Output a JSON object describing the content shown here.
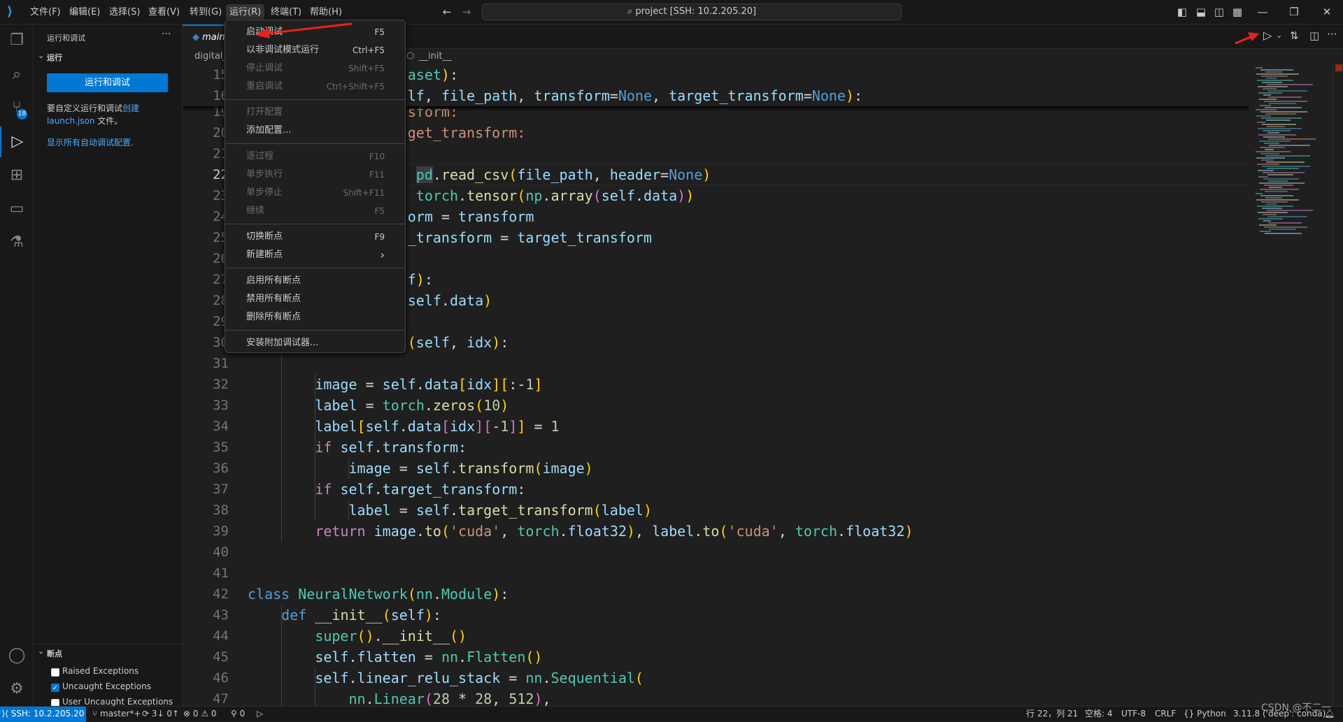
{
  "titlebar": {
    "menus": [
      "文件(F)",
      "编辑(E)",
      "选择(S)",
      "查看(V)",
      "转到(G)",
      "运行(R)",
      "终端(T)",
      "帮助(H)"
    ],
    "active_menu": "运行(R)",
    "search_text": "project [SSH: 10.2.205.20]"
  },
  "activity_bar": {
    "source_control_badge": "18"
  },
  "sidebar": {
    "title": "运行和调试",
    "section": "运行",
    "run_button": "运行和调试",
    "hint_prefix": "要自定义运行和调试",
    "hint_link": "创建",
    "hint_link2": "launch.json",
    "hint_suffix": " 文件。",
    "show_all": "显示所有自动调试配置.",
    "breakpoints_title": "断点",
    "breakpoints": [
      {
        "label": "Raised Exceptions",
        "checked": false
      },
      {
        "label": "Uncaught Exceptions",
        "checked": true
      },
      {
        "label": "User Uncaught Exceptions",
        "checked": false
      }
    ]
  },
  "tabs": [
    {
      "label": "main",
      "preview": true
    }
  ],
  "breadcrumb": {
    "file": "digital_",
    "symbol": "__init__"
  },
  "run_menu": [
    [
      {
        "label": "启动调试",
        "shortcut": "F5",
        "disabled": false
      },
      {
        "label": "以非调试模式运行",
        "shortcut": "Ctrl+F5",
        "disabled": false
      },
      {
        "label": "停止调试",
        "shortcut": "Shift+F5",
        "disabled": true
      },
      {
        "label": "重启调试",
        "shortcut": "Ctrl+Shift+F5",
        "disabled": true
      }
    ],
    [
      {
        "label": "打开配置",
        "shortcut": "",
        "disabled": true
      },
      {
        "label": "添加配置...",
        "shortcut": "",
        "disabled": false
      }
    ],
    [
      {
        "label": "逐过程",
        "shortcut": "F10",
        "disabled": true
      },
      {
        "label": "单步执行",
        "shortcut": "F11",
        "disabled": true
      },
      {
        "label": "单步停止",
        "shortcut": "Shift+F11",
        "disabled": true
      },
      {
        "label": "继续",
        "shortcut": "F5",
        "disabled": true
      }
    ],
    [
      {
        "label": "切换断点",
        "shortcut": "F9",
        "disabled": false
      },
      {
        "label": "新建断点",
        "shortcut": "",
        "submenu": true,
        "disabled": false
      }
    ],
    [
      {
        "label": "启用所有断点",
        "shortcut": "",
        "disabled": false
      },
      {
        "label": "禁用所有断点",
        "shortcut": "",
        "disabled": false
      },
      {
        "label": "删除所有断点",
        "shortcut": "",
        "disabled": false
      }
    ],
    [
      {
        "label": "安装附加调试器...",
        "shortcut": "",
        "disabled": false
      }
    ]
  ],
  "editor": {
    "current_line": 22,
    "sticky": [
      {
        "n": 15,
        "col": 19,
        "tokens": [
          [
            "aset",
            "t"
          ],
          [
            ")",
            "b1"
          ],
          [
            ":",
            "p"
          ]
        ]
      },
      {
        "n": 16,
        "col": 19,
        "tokens": [
          [
            "lf",
            "v"
          ],
          [
            ", ",
            "p"
          ],
          [
            "file_path",
            "v"
          ],
          [
            ", ",
            "p"
          ],
          [
            "transform",
            "v"
          ],
          [
            "=",
            "p"
          ],
          [
            "None",
            "d"
          ],
          [
            ", ",
            "p"
          ],
          [
            "target_transform",
            "v"
          ],
          [
            "=",
            "p"
          ],
          [
            "None",
            "d"
          ],
          [
            ")",
            "b1"
          ],
          [
            ":",
            "p"
          ]
        ]
      }
    ],
    "lines": [
      {
        "n": 19,
        "col": 19,
        "tokens": [
          [
            "sform:",
            "o"
          ]
        ]
      },
      {
        "n": 20,
        "col": 19,
        "tokens": [
          [
            "get_transform:",
            "o"
          ]
        ]
      },
      {
        "n": 21,
        "col": 0,
        "tokens": []
      },
      {
        "n": 22,
        "col": 20,
        "tokens": [
          [
            "pd",
            "t hl"
          ],
          [
            ".",
            "p"
          ],
          [
            "read_csv",
            "f"
          ],
          [
            "(",
            "b1"
          ],
          [
            "file_path",
            "v"
          ],
          [
            ", ",
            "p"
          ],
          [
            "header",
            "v"
          ],
          [
            "=",
            "p"
          ],
          [
            "None",
            "d"
          ],
          [
            ")",
            "b1"
          ]
        ]
      },
      {
        "n": 23,
        "col": 20,
        "tokens": [
          [
            "torch",
            "t"
          ],
          [
            ".",
            "p"
          ],
          [
            "tensor",
            "f"
          ],
          [
            "(",
            "b1"
          ],
          [
            "np",
            "t"
          ],
          [
            ".",
            "p"
          ],
          [
            "array",
            "f"
          ],
          [
            "(",
            "b2"
          ],
          [
            "self",
            "v"
          ],
          [
            ".",
            "p"
          ],
          [
            "data",
            "v"
          ],
          [
            ")",
            "b2"
          ],
          [
            ")",
            "b1"
          ]
        ]
      },
      {
        "n": 24,
        "col": 19,
        "tokens": [
          [
            "orm",
            "v"
          ],
          [
            " = ",
            "p"
          ],
          [
            "transform",
            "v"
          ]
        ]
      },
      {
        "n": 25,
        "col": 19,
        "tokens": [
          [
            "_transform",
            "v"
          ],
          [
            " = ",
            "p"
          ],
          [
            "target_transform",
            "v"
          ]
        ]
      },
      {
        "n": 26,
        "col": 0,
        "tokens": []
      },
      {
        "n": 27,
        "col": 19,
        "tokens": [
          [
            "f",
            "v"
          ],
          [
            ")",
            "b1"
          ],
          [
            ":",
            "p"
          ]
        ]
      },
      {
        "n": 28,
        "col": 19,
        "tokens": [
          [
            "self",
            "v"
          ],
          [
            ".",
            "p"
          ],
          [
            "data",
            "v"
          ],
          [
            ")",
            "b1"
          ]
        ]
      },
      {
        "n": 29,
        "col": 0,
        "tokens": []
      },
      {
        "n": 30,
        "col": 19,
        "tokens": [
          [
            "(",
            "b1"
          ],
          [
            "self",
            "v"
          ],
          [
            ", ",
            "p"
          ],
          [
            "idx",
            "v"
          ],
          [
            ")",
            "b1"
          ],
          [
            ":",
            "p"
          ]
        ]
      },
      {
        "n": 31,
        "col": 0,
        "tokens": []
      },
      {
        "n": 32,
        "col": 8,
        "tokens": [
          [
            "image",
            "v"
          ],
          [
            " = ",
            "p"
          ],
          [
            "self",
            "v"
          ],
          [
            ".",
            "p"
          ],
          [
            "data",
            "v"
          ],
          [
            "[",
            "b1"
          ],
          [
            "idx",
            "v"
          ],
          [
            "]",
            "b1"
          ],
          [
            "[",
            "b1"
          ],
          [
            ":-",
            "p"
          ],
          [
            "1",
            "n"
          ],
          [
            "]",
            "b1"
          ]
        ]
      },
      {
        "n": 33,
        "col": 8,
        "tokens": [
          [
            "label",
            "v"
          ],
          [
            " = ",
            "p"
          ],
          [
            "torch",
            "t"
          ],
          [
            ".",
            "p"
          ],
          [
            "zeros",
            "f"
          ],
          [
            "(",
            "b1"
          ],
          [
            "10",
            "n"
          ],
          [
            ")",
            "b1"
          ]
        ]
      },
      {
        "n": 34,
        "col": 8,
        "tokens": [
          [
            "label",
            "v"
          ],
          [
            "[",
            "b1"
          ],
          [
            "self",
            "v"
          ],
          [
            ".",
            "p"
          ],
          [
            "data",
            "v"
          ],
          [
            "[",
            "b2"
          ],
          [
            "idx",
            "v"
          ],
          [
            "]",
            "b2"
          ],
          [
            "[",
            "b2"
          ],
          [
            "-",
            "p"
          ],
          [
            "1",
            "n"
          ],
          [
            "]",
            "b2"
          ],
          [
            "]",
            "b1"
          ],
          [
            " = ",
            "p"
          ],
          [
            "1",
            "n"
          ]
        ]
      },
      {
        "n": 35,
        "col": 8,
        "tokens": [
          [
            "if",
            "k"
          ],
          [
            " ",
            "p"
          ],
          [
            "self",
            "v"
          ],
          [
            ".",
            "p"
          ],
          [
            "transform",
            "v"
          ],
          [
            ":",
            "p"
          ]
        ]
      },
      {
        "n": 36,
        "col": 12,
        "tokens": [
          [
            "image",
            "v"
          ],
          [
            " = ",
            "p"
          ],
          [
            "self",
            "v"
          ],
          [
            ".",
            "p"
          ],
          [
            "transform",
            "f"
          ],
          [
            "(",
            "b1"
          ],
          [
            "image",
            "v"
          ],
          [
            ")",
            "b1"
          ]
        ]
      },
      {
        "n": 37,
        "col": 8,
        "tokens": [
          [
            "if",
            "k"
          ],
          [
            " ",
            "p"
          ],
          [
            "self",
            "v"
          ],
          [
            ".",
            "p"
          ],
          [
            "target_transform",
            "v"
          ],
          [
            ":",
            "p"
          ]
        ]
      },
      {
        "n": 38,
        "col": 12,
        "tokens": [
          [
            "label",
            "v"
          ],
          [
            " = ",
            "p"
          ],
          [
            "self",
            "v"
          ],
          [
            ".",
            "p"
          ],
          [
            "target_transform",
            "f"
          ],
          [
            "(",
            "b1"
          ],
          [
            "label",
            "v"
          ],
          [
            ")",
            "b1"
          ]
        ]
      },
      {
        "n": 39,
        "col": 8,
        "tokens": [
          [
            "return",
            "k"
          ],
          [
            " ",
            "p"
          ],
          [
            "image",
            "v"
          ],
          [
            ".",
            "p"
          ],
          [
            "to",
            "f"
          ],
          [
            "(",
            "b1"
          ],
          [
            "'cuda'",
            "s"
          ],
          [
            ", ",
            "p"
          ],
          [
            "torch",
            "t"
          ],
          [
            ".",
            "p"
          ],
          [
            "float32",
            "v"
          ],
          [
            ")",
            "b1"
          ],
          [
            ", ",
            "p"
          ],
          [
            "label",
            "v"
          ],
          [
            ".",
            "p"
          ],
          [
            "to",
            "f"
          ],
          [
            "(",
            "b1"
          ],
          [
            "'cuda'",
            "s"
          ],
          [
            ", ",
            "p"
          ],
          [
            "torch",
            "t"
          ],
          [
            ".",
            "p"
          ],
          [
            "float32",
            "v"
          ],
          [
            ")",
            "b1"
          ]
        ]
      },
      {
        "n": 40,
        "col": 0,
        "tokens": []
      },
      {
        "n": 41,
        "col": 0,
        "tokens": []
      },
      {
        "n": 42,
        "col": 0,
        "tokens": [
          [
            "class",
            "d"
          ],
          [
            " ",
            "p"
          ],
          [
            "NeuralNetwork",
            "t"
          ],
          [
            "(",
            "b1"
          ],
          [
            "nn",
            "t"
          ],
          [
            ".",
            "p"
          ],
          [
            "Module",
            "t"
          ],
          [
            ")",
            "b1"
          ],
          [
            ":",
            "p"
          ]
        ]
      },
      {
        "n": 43,
        "col": 4,
        "tokens": [
          [
            "def",
            "d"
          ],
          [
            " ",
            "p"
          ],
          [
            "__init__",
            "f"
          ],
          [
            "(",
            "b1"
          ],
          [
            "self",
            "v"
          ],
          [
            ")",
            "b1"
          ],
          [
            ":",
            "p"
          ]
        ]
      },
      {
        "n": 44,
        "col": 8,
        "tokens": [
          [
            "super",
            "t"
          ],
          [
            "()",
            "b1"
          ],
          [
            ".",
            "p"
          ],
          [
            "__init__",
            "f"
          ],
          [
            "()",
            "b1"
          ]
        ]
      },
      {
        "n": 45,
        "col": 8,
        "tokens": [
          [
            "self",
            "v"
          ],
          [
            ".",
            "p"
          ],
          [
            "flatten",
            "v"
          ],
          [
            " = ",
            "p"
          ],
          [
            "nn",
            "t"
          ],
          [
            ".",
            "p"
          ],
          [
            "Flatten",
            "t"
          ],
          [
            "()",
            "b1"
          ]
        ]
      },
      {
        "n": 46,
        "col": 8,
        "tokens": [
          [
            "self",
            "v"
          ],
          [
            ".",
            "p"
          ],
          [
            "linear_relu_stack",
            "v"
          ],
          [
            " = ",
            "p"
          ],
          [
            "nn",
            "t"
          ],
          [
            ".",
            "p"
          ],
          [
            "Sequential",
            "t"
          ],
          [
            "(",
            "b1"
          ]
        ]
      },
      {
        "n": 47,
        "col": 12,
        "tokens": [
          [
            "nn",
            "t"
          ],
          [
            ".",
            "p"
          ],
          [
            "Linear",
            "t"
          ],
          [
            "(",
            "b2"
          ],
          [
            "28",
            "n"
          ],
          [
            " * ",
            "p"
          ],
          [
            "28",
            "n"
          ],
          [
            ", ",
            "p"
          ],
          [
            "512",
            "n"
          ],
          [
            ")",
            "b2"
          ],
          [
            ",",
            "p"
          ]
        ]
      }
    ]
  },
  "statusbar": {
    "remote": "SSH: 10.2.205.20",
    "branch": "master*+",
    "sync": "3↓ 0↑",
    "errors": "0",
    "warnings": "0",
    "ports": "0",
    "position": "行 22，列 21",
    "spaces": "空格: 4",
    "encoding": "UTF-8",
    "eol": "CRLF",
    "language": "Python",
    "interpreter": "3.11.8 ('deep': conda)",
    "watermark": "CSDN @不二一"
  },
  "colors": {
    "accent": "#0078d4",
    "annotation_arrow": "#e8211d"
  }
}
